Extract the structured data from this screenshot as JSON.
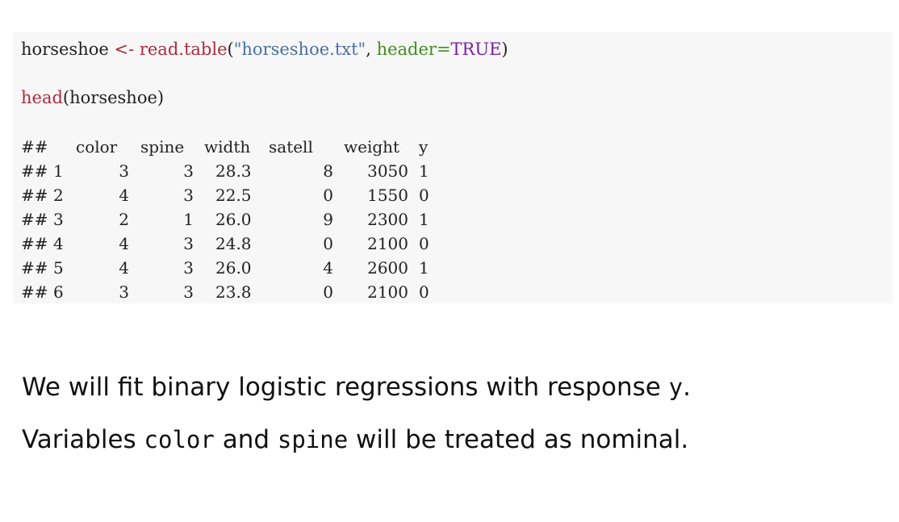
{
  "code": {
    "line1": {
      "var": "horseshoe",
      "assign": " <- ",
      "fn": "read.table",
      "open": "(",
      "str": "\"horseshoe.txt\"",
      "comma": ", ",
      "arg": "header=",
      "const": "TRUE",
      "close": ")"
    },
    "line2": {
      "fn": "head",
      "rest": "(horseshoe)"
    }
  },
  "output": {
    "prefix": "##",
    "headers": [
      "color",
      "spine",
      "width",
      "satell",
      "weight",
      "y"
    ],
    "rows": [
      {
        "idx": "1",
        "color": "3",
        "spine": "3",
        "width": "28.3",
        "satell": "8",
        "weight": "3050",
        "y": "1"
      },
      {
        "idx": "2",
        "color": "4",
        "spine": "3",
        "width": "22.5",
        "satell": "0",
        "weight": "1550",
        "y": "0"
      },
      {
        "idx": "3",
        "color": "2",
        "spine": "1",
        "width": "26.0",
        "satell": "9",
        "weight": "2300",
        "y": "1"
      },
      {
        "idx": "4",
        "color": "4",
        "spine": "3",
        "width": "24.8",
        "satell": "0",
        "weight": "2100",
        "y": "0"
      },
      {
        "idx": "5",
        "color": "4",
        "spine": "3",
        "width": "26.0",
        "satell": "4",
        "weight": "2600",
        "y": "1"
      },
      {
        "idx": "6",
        "color": "3",
        "spine": "3",
        "width": "23.8",
        "satell": "0",
        "weight": "2100",
        "y": "0"
      }
    ]
  },
  "prose": {
    "p1": {
      "a": "We will fit binary logistic regressions with response ",
      "code": "y",
      "b": "."
    },
    "p2": {
      "a": "Variables ",
      "code1": "color",
      "b": " and ",
      "code2": "spine",
      "c": " will be treated as nominal."
    }
  },
  "colors": {
    "code_bg": "#f7f7f7",
    "keyword": "#b02a3c",
    "string": "#4a6fa5",
    "argument": "#3e8e1e",
    "constant": "#7a1fa2"
  }
}
